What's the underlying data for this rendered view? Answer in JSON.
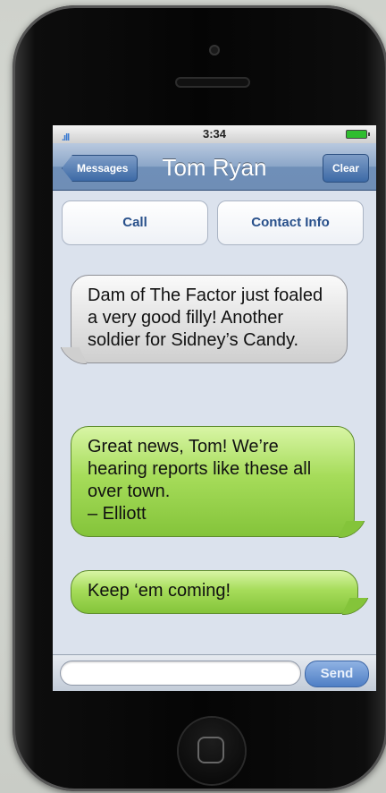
{
  "status_bar": {
    "time": "3:34",
    "signal": ".ıll"
  },
  "nav": {
    "back_label": "Messages",
    "title": "Tom Ryan",
    "clear_label": "Clear"
  },
  "actions": {
    "call_label": "Call",
    "contact_label": "Contact Info"
  },
  "messages": [
    {
      "sender": "other",
      "text": "Dam of The Factor just foaled a very good filly! Another soldier for Sidney’s Candy."
    },
    {
      "sender": "me",
      "text": "Great news, Tom! We’re hearing reports like these all over town.\n– Elliott"
    },
    {
      "sender": "me",
      "text": "Keep ‘em coming!"
    }
  ],
  "composer": {
    "input_value": "",
    "send_label": "Send"
  },
  "colors": {
    "incoming_bubble": "#d8d8d8",
    "outgoing_bubble": "#a6dc5a",
    "nav_bar": "#6f8fb8",
    "screen_bg": "#dbe2ed"
  }
}
